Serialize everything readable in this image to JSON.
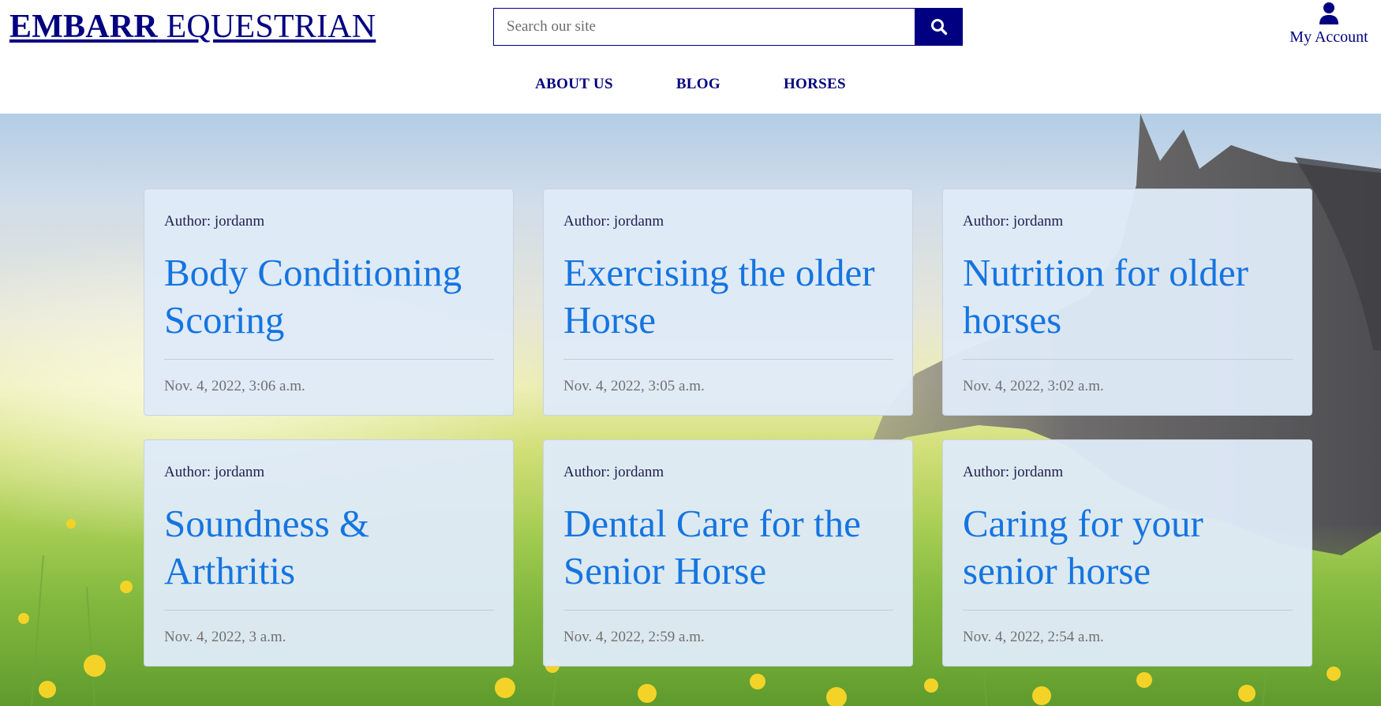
{
  "header": {
    "logo_bold": "EMBARR",
    "logo_light": "EQUESTRIAN",
    "search_placeholder": "Search our site",
    "account_label": "My Account",
    "icons": {
      "search": "search-icon",
      "account": "user-icon"
    }
  },
  "nav": {
    "items": [
      {
        "label": "ABOUT US"
      },
      {
        "label": "BLOG"
      },
      {
        "label": "HORSES"
      }
    ]
  },
  "posts": [
    {
      "author": "Author: jordanm",
      "title": "Body Conditioning Scoring",
      "date": "Nov. 4, 2022, 3:06 a.m."
    },
    {
      "author": "Author: jordanm",
      "title": "Exercising the older Horse",
      "date": "Nov. 4, 2022, 3:05 a.m."
    },
    {
      "author": "Author: jordanm",
      "title": "Nutrition for older horses",
      "date": "Nov. 4, 2022, 3:02 a.m."
    },
    {
      "author": "Author: jordanm",
      "title": "Soundness & Arthritis",
      "date": "Nov. 4, 2022, 3 a.m."
    },
    {
      "author": "Author: jordanm",
      "title": "Dental Care for the Senior Horse",
      "date": "Nov. 4, 2022, 2:59 a.m."
    },
    {
      "author": "Author: jordanm",
      "title": "Caring for your senior horse",
      "date": "Nov. 4, 2022, 2:54 a.m."
    }
  ],
  "colors": {
    "brand_navy": "#000080",
    "link_blue": "#1575e0",
    "card_bg": "#dfeaf8",
    "date_gray": "#707070"
  }
}
